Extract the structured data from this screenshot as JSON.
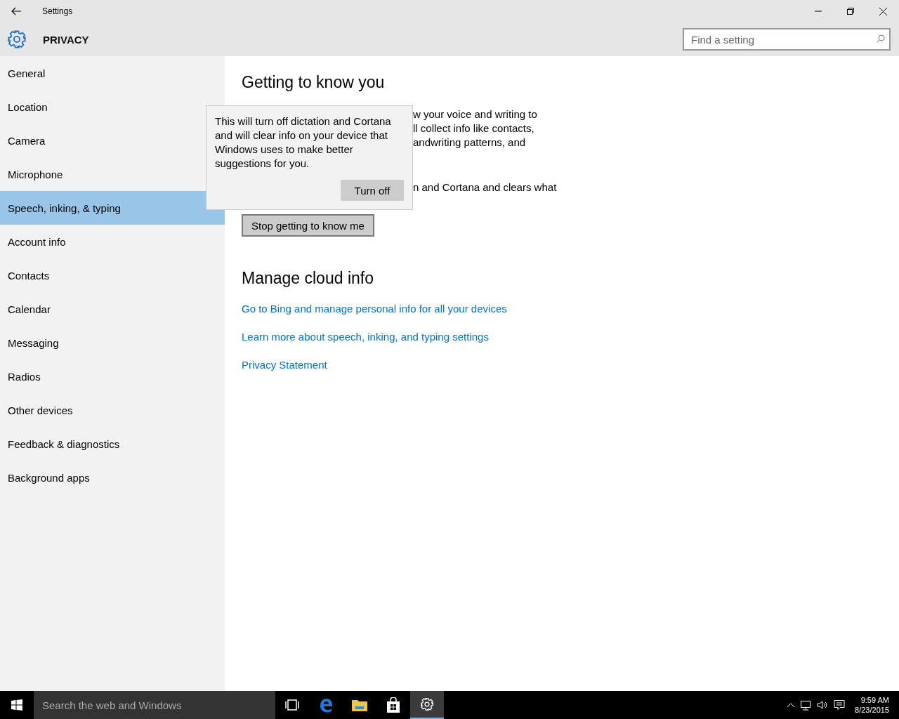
{
  "window": {
    "title": "Settings"
  },
  "header": {
    "title": "PRIVACY",
    "search": {
      "placeholder": "Find a setting"
    }
  },
  "sidebar": {
    "items": [
      {
        "label": "General",
        "selected": false
      },
      {
        "label": "Location",
        "selected": false
      },
      {
        "label": "Camera",
        "selected": false
      },
      {
        "label": "Microphone",
        "selected": false
      },
      {
        "label": "Speech, inking, & typing",
        "selected": true
      },
      {
        "label": "Account info",
        "selected": false
      },
      {
        "label": "Contacts",
        "selected": false
      },
      {
        "label": "Calendar",
        "selected": false
      },
      {
        "label": "Messaging",
        "selected": false
      },
      {
        "label": "Radios",
        "selected": false
      },
      {
        "label": "Other devices",
        "selected": false
      },
      {
        "label": "Feedback & diagnostics",
        "selected": false
      },
      {
        "label": "Background apps",
        "selected": false
      }
    ]
  },
  "content": {
    "heading": "Getting to know you",
    "paragraphs": [
      [
        "w your voice and writing to",
        "ll collect info like contacts,",
        "andwriting patterns, and"
      ],
      [
        "n and Cortana and clears what"
      ]
    ],
    "button": "Stop getting to know me",
    "section_heading": "Manage cloud info",
    "links": [
      "Go to Bing and manage personal info for all your devices",
      "Learn more about speech, inking, and typing settings",
      "Privacy Statement"
    ]
  },
  "popup": {
    "text": "This will turn off dictation and Cortana and will clear info on your device that Windows uses to make better suggestions for you.",
    "button": "Turn off"
  },
  "taskbar": {
    "search": {
      "placeholder": "Search the web and Windows"
    },
    "apps": [
      {
        "kind": "taskview",
        "selected": false
      },
      {
        "kind": "edge",
        "selected": false
      },
      {
        "kind": "folder",
        "selected": false
      },
      {
        "kind": "store",
        "selected": false
      },
      {
        "kind": "settings",
        "selected": true
      }
    ],
    "clock": {
      "time": "9:59 AM",
      "date": "8/23/2015"
    }
  }
}
